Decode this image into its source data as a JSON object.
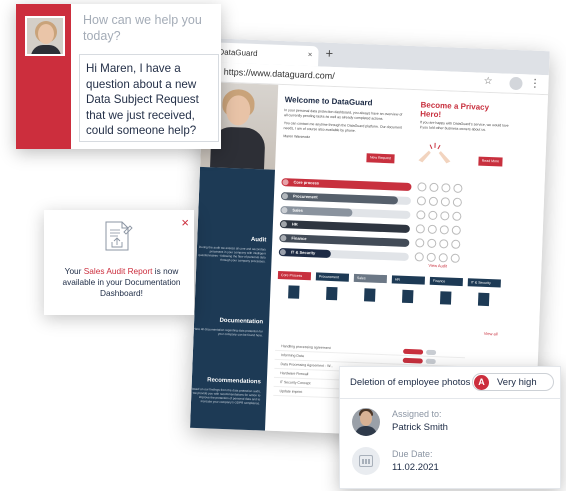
{
  "browser": {
    "tab_title": "DataGuard",
    "tab_close": "×",
    "new_tab": "+",
    "url": "https://www.dataguard.com/",
    "star": "☆",
    "menu": "⋮"
  },
  "dashboard": {
    "welcome_title": "Welcome to DataGuard",
    "welcome_text_1": "In your personal data protection dashboard, you always have an overview of all currently pending tasks as well as already completed actions.",
    "welcome_text_2": "You can contact me anytime through the DataGuard platform. Our document needs, I am of course also available by phone.",
    "welcome_sign": "Maren Warsewitz",
    "new_request_label": "New Request",
    "privacy_title": "Become a Privacy Hero!",
    "privacy_text": "If you are happy with DataGuard's service, we would love if you told other business owners about us.",
    "read_more_label": "Read More",
    "audit_title": "Audit",
    "audit_text": "During the audit we assess all core and secondary processes in your company with intelligent questionnaires - following the flow of personal data through your company processes.",
    "documentation_title": "Documentation",
    "documentation_text": "Here all documentation regarding data protection for your company can be found here.",
    "recommendations_title": "Recommendations",
    "recommendations_text": "Based on our findings from the data protection audit, we provide you with recommendations for action to improve the protection of personal data and to increase your company's GDPR compliance.",
    "process_bars": [
      {
        "label": "Core process",
        "color": "#c8303e",
        "fill": 1.0
      },
      {
        "label": "Procurement",
        "color": "#56606c",
        "fill": 0.9
      },
      {
        "label": "Sales",
        "color": "#8a939e",
        "fill": 0.55
      },
      {
        "label": "HR",
        "color": "#2e3540",
        "fill": 1.0
      },
      {
        "label": "Finance",
        "color": "#424b57",
        "fill": 1.0
      },
      {
        "label": "IT & Security",
        "color": "#1d2b45",
        "fill": 0.4
      }
    ],
    "view_audit_label": "View Audit",
    "doc_tabs": [
      {
        "label": "Core Process",
        "color": "#c8303e"
      },
      {
        "label": "Procurement",
        "color": "#1d3a55"
      },
      {
        "label": "Sales",
        "color": "#6c7886"
      },
      {
        "label": "HR",
        "color": "#1d3a55"
      },
      {
        "label": "Finance",
        "color": "#1d3a55"
      },
      {
        "label": "IT & Security",
        "color": "#1d3a55"
      }
    ],
    "view_all_label": "View all",
    "tasks": [
      "Handling processing agreement",
      "Informing Data",
      "Data Processing Agreement - W...",
      "Hardware Firewall",
      "IT Security Concept",
      "Update imprint"
    ],
    "task_tag": "Very high"
  },
  "chat": {
    "placeholder": "How can we help you today?",
    "message": "Hi Maren, I have a question about a new Data Subject Request that we just received, could someone help?",
    "accent_color": "#cc2e3d"
  },
  "audit_card": {
    "close": "×",
    "text_prefix": "Your ",
    "highlight": "Sales Audit Report",
    "text_suffix": " is now available in your Documentation Dashboard!"
  },
  "task_card": {
    "title": "Deletion of employee photos",
    "priority_letter": "A",
    "priority_label": "Very high",
    "assigned_label": "Assigned to:",
    "assignee": "Patrick Smith",
    "due_label": "Due Date:",
    "due_date": "11.02.2021"
  }
}
